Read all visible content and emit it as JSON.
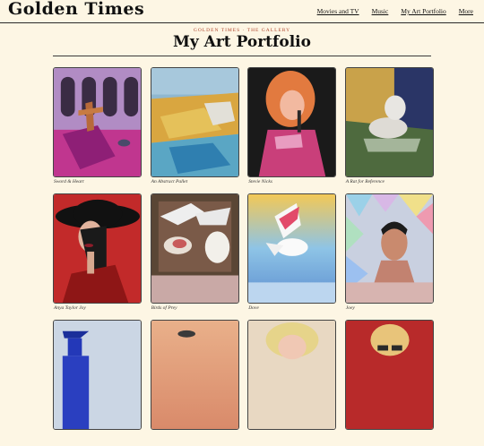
{
  "header": {
    "logo": "Golden Times",
    "nav": [
      "Movies and TV",
      "Music",
      "My Art Portfolio",
      "More"
    ]
  },
  "page": {
    "kicker": "GOLDEN TIMES · THE GALLERY",
    "title": "My Art Portfolio"
  },
  "gallery": {
    "items": [
      {
        "caption": "Sword & Heart"
      },
      {
        "caption": "An Abstract Pallet"
      },
      {
        "caption": "Stevie Nicks"
      },
      {
        "caption": "A Rat for Reference"
      },
      {
        "caption": "Anya Taylor Joy"
      },
      {
        "caption": "Birds of Prey"
      },
      {
        "caption": "Dove"
      },
      {
        "caption": "Joey"
      },
      {
        "caption": ""
      },
      {
        "caption": ""
      },
      {
        "caption": ""
      },
      {
        "caption": ""
      }
    ]
  },
  "colors": {
    "background": "#fdf6e4",
    "kicker": "#b0442c"
  }
}
